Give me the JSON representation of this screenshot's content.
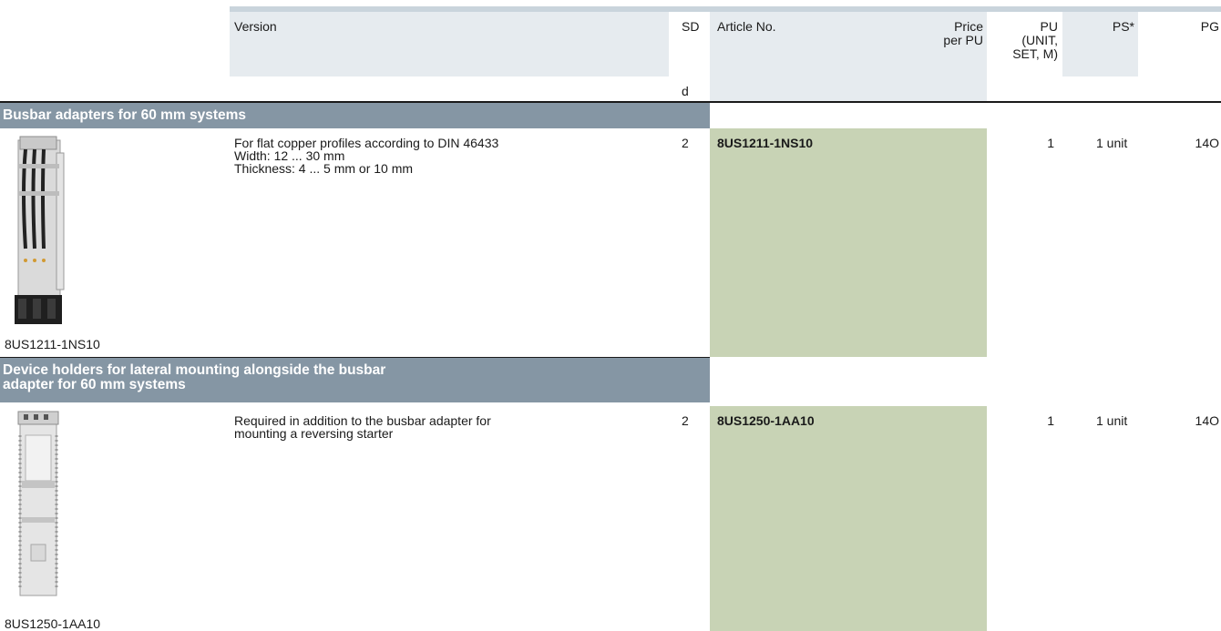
{
  "header": {
    "version": "Version",
    "sd": "SD",
    "sd_unit": "d",
    "article_no": "Article No.",
    "price_line1": "Price",
    "price_line2": "per PU",
    "pu_line1": "PU",
    "pu_line2": "(UNIT,",
    "pu_line3": "SET, M)",
    "ps": "PS*",
    "pg": "PG"
  },
  "sections": [
    {
      "title_line1": "Busbar adapters for 60 mm systems",
      "title_line2": "",
      "product": {
        "description": [
          "For flat copper profiles according to DIN 46433",
          "Width: 12 ... 30 mm",
          "Thickness: 4 ... 5 mm or 10 mm"
        ],
        "sd": "2",
        "article_no": "8US1211-1NS10",
        "pu": "1",
        "ps": "1 unit",
        "pg": "14O",
        "image_caption": "8US1211-1NS10"
      }
    },
    {
      "title_line1": "Device holders for lateral mounting alongside the busbar",
      "title_line2": "adapter for 60 mm systems",
      "product": {
        "description": [
          "Required in addition to the busbar adapter for",
          "mounting a reversing starter"
        ],
        "sd": "2",
        "article_no": "8US1250-1AA10",
        "pu": "1",
        "ps": "1 unit",
        "pg": "14O",
        "image_caption": "8US1250-1AA10"
      }
    }
  ]
}
